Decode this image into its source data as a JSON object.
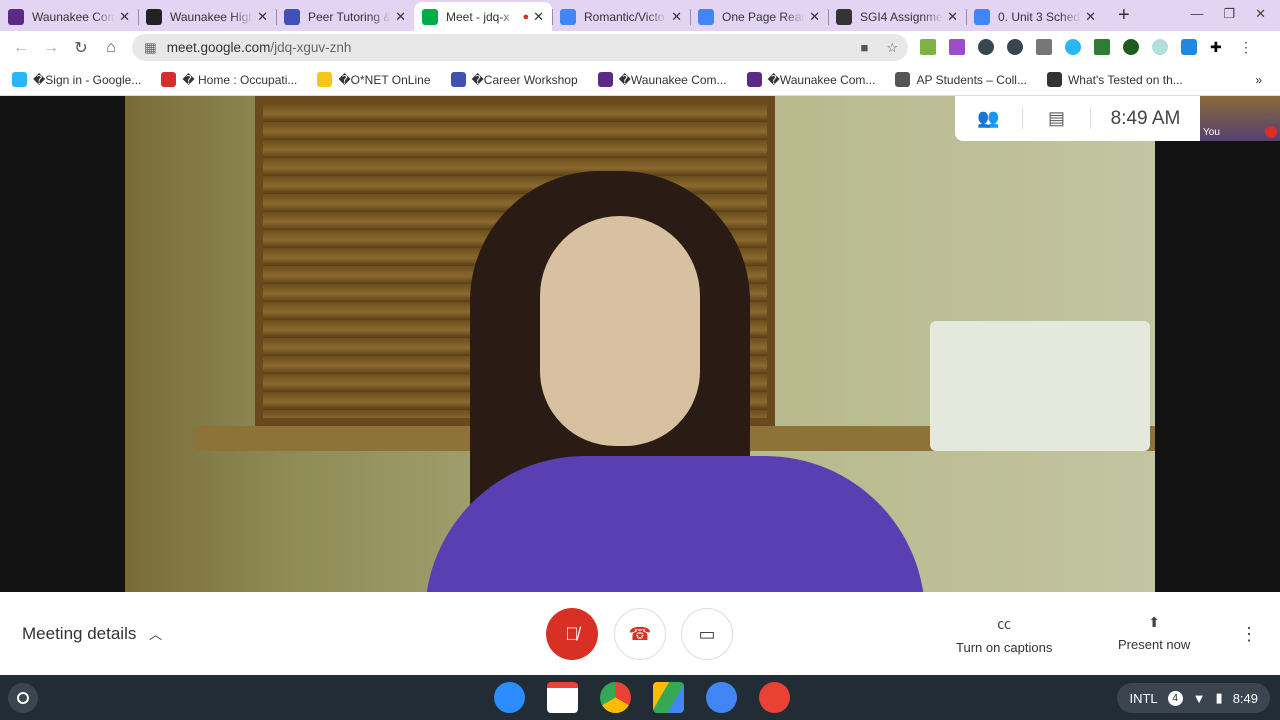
{
  "tabs": [
    {
      "title": "Waunakee Com",
      "icon": "waunakee-w-icon",
      "color": "#5b2a86"
    },
    {
      "title": "Waunakee High",
      "icon": "schoology-icon",
      "color": "#222"
    },
    {
      "title": "Peer Tutoring &",
      "icon": "forms-icon",
      "color": "#3f51b5"
    },
    {
      "title": "Meet - jdq-x",
      "icon": "meet-icon",
      "color": "#00ac47",
      "active": true
    },
    {
      "title": "Romantic/Victo",
      "icon": "docs-icon",
      "color": "#4285f4"
    },
    {
      "title": "One Page Read",
      "icon": "docs-icon",
      "color": "#4285f4"
    },
    {
      "title": "SGI4 Assignme",
      "icon": "globe-icon",
      "color": "#333"
    },
    {
      "title": "0. Unit 3 Sched",
      "icon": "docs-icon",
      "color": "#4285f4"
    }
  ],
  "address": {
    "host": "meet.google.com",
    "path": "/jdq-xguv-znh"
  },
  "bookmarks": [
    {
      "label": "�Sign in - Google...",
      "color": "#29b6f6"
    },
    {
      "label": "� Home : Occupati...",
      "color": "#d32f2f"
    },
    {
      "label": "�O*NET OnLine",
      "color": "#f5c518"
    },
    {
      "label": "�Career Workshop",
      "color": "#3f51b5"
    },
    {
      "label": "�Waunakee Com...",
      "color": "#5b2a86"
    },
    {
      "label": "�Waunakee Com...",
      "color": "#5b2a86"
    },
    {
      "label": "AP Students – Coll...",
      "color": "#555"
    },
    {
      "label": "What's Tested on th...",
      "color": "#333"
    }
  ],
  "meet": {
    "time": "8:49 AM",
    "self_label": "You",
    "meeting_details": "Meeting details",
    "captions": "Turn on captions",
    "present": "Present now",
    "mic_muted": true,
    "accent": "#d93025"
  },
  "shelf": {
    "ime": "INTL",
    "notif_count": "4",
    "clock": "8:49"
  }
}
